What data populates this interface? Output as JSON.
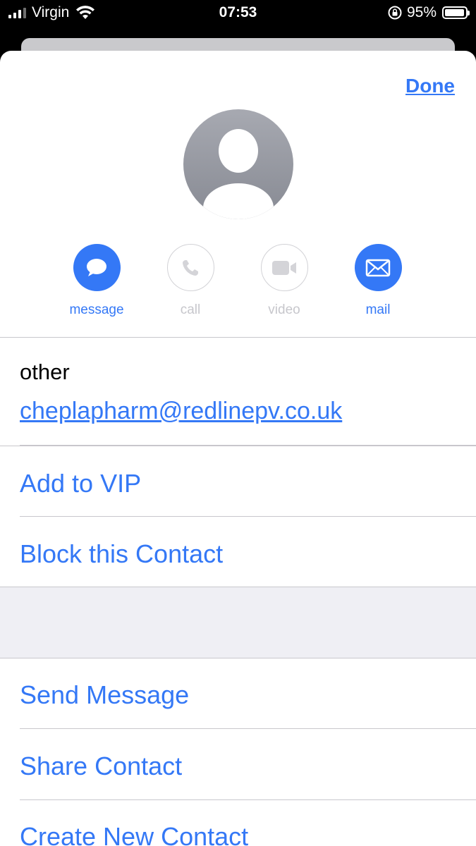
{
  "status_bar": {
    "carrier": "Virgin",
    "time": "07:53",
    "battery_percent": "95%",
    "battery_level": 0.95
  },
  "sheet": {
    "done_label": "Done",
    "avatar_icon": "person-placeholder-icon"
  },
  "actions": [
    {
      "label": "message",
      "icon": "speech-bubble-icon",
      "enabled": true
    },
    {
      "label": "call",
      "icon": "phone-icon",
      "enabled": false
    },
    {
      "label": "video",
      "icon": "video-camera-icon",
      "enabled": false
    },
    {
      "label": "mail",
      "icon": "envelope-icon",
      "enabled": true
    }
  ],
  "email": {
    "label": "other",
    "value": "cheplapharm@redlinepv.co.uk"
  },
  "options_group_1": [
    "Add to VIP",
    "Block this Contact"
  ],
  "options_group_2": [
    "Send Message",
    "Share Contact",
    "Create New Contact"
  ],
  "colors": {
    "accent": "#3478f6",
    "disabled": "#c7c7cc",
    "group_background": "#efeff4"
  }
}
